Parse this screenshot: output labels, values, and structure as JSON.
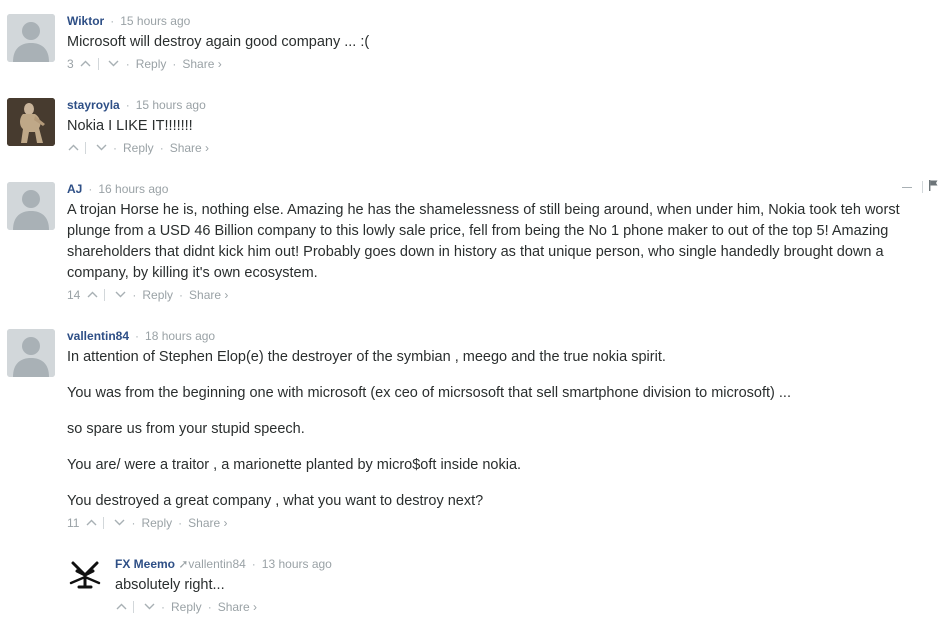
{
  "comments": [
    {
      "author": "Wiktor",
      "time": "15 hours ago",
      "paragraphs": [
        "Microsoft will destroy again good company ... :("
      ],
      "votes": "3",
      "reply": "Reply",
      "share": "Share ›"
    },
    {
      "author": "stayroyla",
      "time": "15 hours ago",
      "paragraphs": [
        "Nokia I LIKE IT!!!!!!!"
      ],
      "votes": "",
      "reply": "Reply",
      "share": "Share ›"
    },
    {
      "author": "AJ",
      "time": "16 hours ago",
      "paragraphs": [
        "A trojan Horse he is, nothing else. Amazing he has the shamelessness of still being around, when under him, Nokia took teh worst plunge from a USD 46 Billion company to this lowly sale price, fell from being the No 1 phone maker to out of the top 5! Amazing shareholders that didnt kick him out! Probably goes down in history as that unique person, who single handedly brought down a company, by killing it's own ecosystem."
      ],
      "votes": "14",
      "reply": "Reply",
      "share": "Share ›"
    },
    {
      "author": "vallentin84",
      "time": "18 hours ago",
      "paragraphs": [
        "In attention of Stephen Elop(e) the destroyer of the symbian , meego and the true nokia spirit.",
        "You was from the beginning one with microsoft (ex ceo of micrsosoft that sell smartphone division to microsoft) ...",
        "so spare us from your stupid speech.",
        "You are/ were a traitor , a marionette planted by micro$oft inside nokia.",
        "You destroyed a great company , what you want to destroy next?"
      ],
      "votes": "11",
      "reply": "Reply",
      "share": "Share ›"
    },
    {
      "author": "FX Meemo",
      "reply_to": "vallentin84",
      "time": "13 hours ago",
      "paragraphs": [
        "absolutely right..."
      ],
      "votes": "",
      "reply": "Reply",
      "share": "Share ›"
    }
  ],
  "colors": {
    "author": "#2e4f86",
    "meta": "#9aa2a6",
    "text": "#2a2e2e",
    "avatar_bg": "#d2d7da"
  },
  "icons": {
    "upvote": "chevron-up-icon",
    "downvote": "chevron-down-icon",
    "collapse": "minus-icon",
    "flag": "flag-icon",
    "reply_arrow": "reply-arrow-icon"
  }
}
